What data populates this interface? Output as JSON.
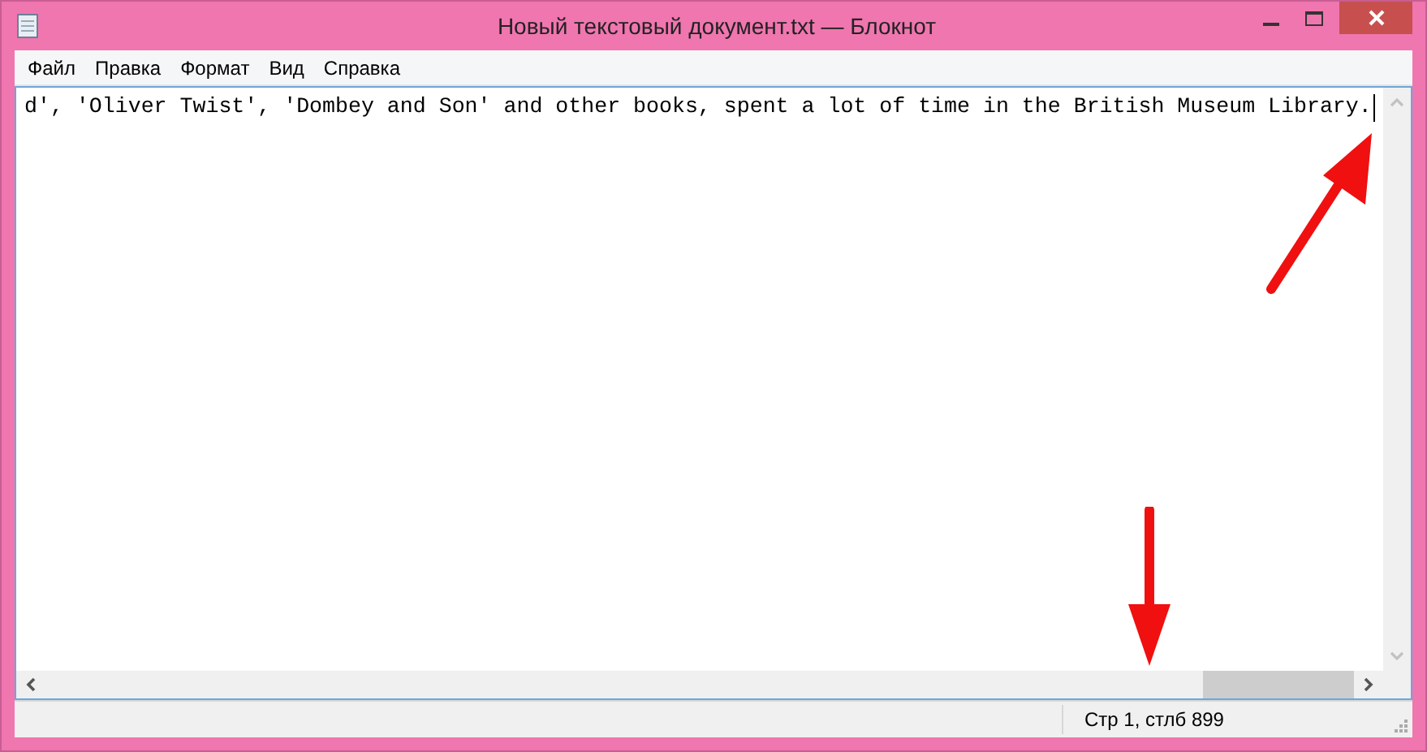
{
  "window": {
    "title": "Новый текстовый документ.txt — Блокнот"
  },
  "menu": [
    "Файл",
    "Правка",
    "Формат",
    "Вид",
    "Справка"
  ],
  "editor": {
    "text": "d', 'Oliver Twist', 'Dombey and Son' and other books, spent a lot of time in the British Museum Library."
  },
  "status_bar": {
    "position": "Стр 1, стлб 899"
  }
}
